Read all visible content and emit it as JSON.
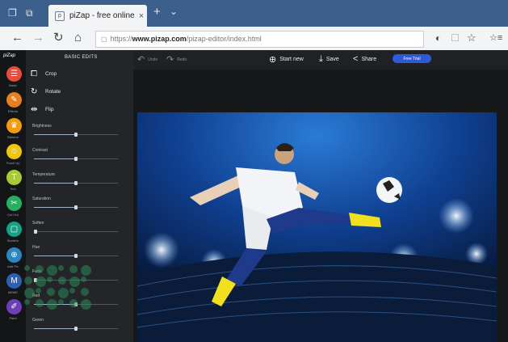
{
  "browser": {
    "tab_title": "piZap - free online pho",
    "tab_close": "×",
    "new_tab": "+",
    "tab_menu": "⌄",
    "url_protocol": "https://",
    "url_host": "www.pizap.com",
    "url_path": "/pizap-editor/index.html",
    "nav": {
      "back": "←",
      "forward": "→",
      "refresh": "↻",
      "home": "⌂"
    },
    "toolbar_icons": {
      "reader": "◐",
      "reading_list": "☐",
      "favorite": "☆",
      "hub": "☆≡",
      "lock": "🔒"
    }
  },
  "app": {
    "logo": "piZap",
    "panel_title": "BASIC EDITS",
    "panel_actions": [
      {
        "icon": "crop-icon",
        "glyph": "⧠",
        "label": "Crop"
      },
      {
        "icon": "rotate-icon",
        "glyph": "↻",
        "label": "Rotate"
      },
      {
        "icon": "flip-icon",
        "glyph": "⇹",
        "label": "Flip"
      }
    ],
    "sliders": [
      {
        "label": "Brightness",
        "value": 0.5
      },
      {
        "label": "Contrast",
        "value": 0.5
      },
      {
        "label": "Temperature",
        "value": 0.5
      },
      {
        "label": "Saturation",
        "value": 0.5
      },
      {
        "label": "Soften",
        "value": 0.02
      },
      {
        "label": "Hue",
        "value": 0.5
      },
      {
        "label": "Fade",
        "value": 0.02
      },
      {
        "label": "Red",
        "value": 0.5
      },
      {
        "label": "Green",
        "value": 0.5
      }
    ],
    "tools": [
      {
        "label": "Basic",
        "color": "#e74c3c",
        "glyph": "☰"
      },
      {
        "label": "Effects",
        "color": "#e67e22",
        "glyph": "✎"
      },
      {
        "label": "Stickers",
        "color": "#f39c12",
        "glyph": "♛"
      },
      {
        "label": "Touch Up",
        "color": "#f1c40f",
        "glyph": "☺"
      },
      {
        "label": "Text",
        "color": "#a8c93a",
        "glyph": "T"
      },
      {
        "label": "Cut Out",
        "color": "#27ae60",
        "glyph": "✂"
      },
      {
        "label": "Borders",
        "color": "#16a085",
        "glyph": "▢"
      },
      {
        "label": "Add Pic",
        "color": "#2e86c1",
        "glyph": "⊕"
      },
      {
        "label": "MEME",
        "color": "#2f5fb3",
        "glyph": "M"
      },
      {
        "label": "Paint",
        "color": "#6c3fb5",
        "glyph": "✐"
      }
    ],
    "topbar": {
      "undo": "Undo",
      "redo": "Redo",
      "start_new": "Start new",
      "save": "Save",
      "share": "Share",
      "free_trial": "Free Trial"
    },
    "colors": {
      "brand_blue": "#2d5bd8",
      "panel_bg": "#232528"
    }
  }
}
